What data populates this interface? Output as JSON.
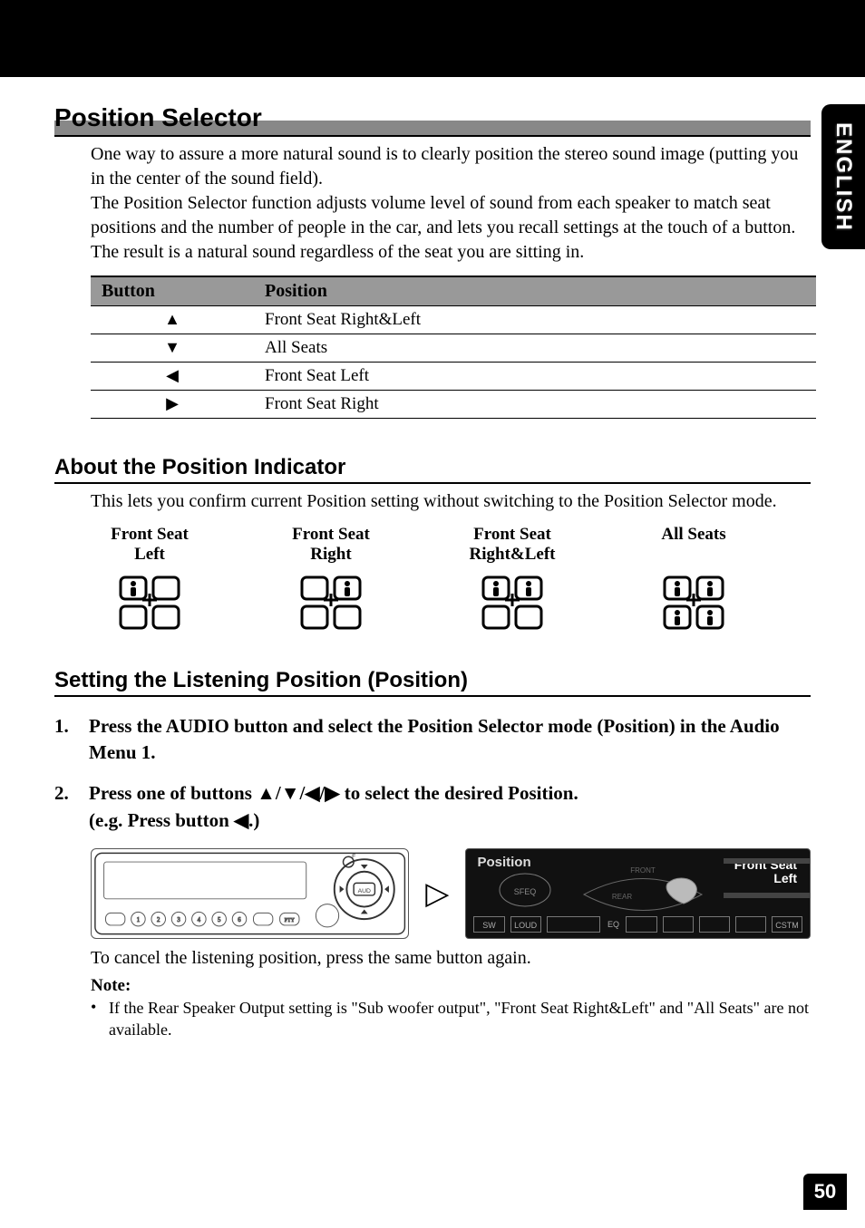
{
  "language_tab": "ENGLISH",
  "page_number": "50",
  "section_title": "Position Selector",
  "intro_paragraph": "One way to assure a more natural sound is to clearly position the stereo sound image (putting you in the center of the sound field).\nThe Position Selector function adjusts volume level of sound from each speaker to match seat positions and the number of people in the car, and lets you recall settings at the touch of a button. The result is a natural sound regardless of the seat you are sitting in.",
  "table": {
    "headers": [
      "Button",
      "Position"
    ],
    "rows": [
      {
        "button": "▲",
        "position": "Front Seat Right&Left"
      },
      {
        "button": "▼",
        "position": "All Seats"
      },
      {
        "button": "◀",
        "position": "Front Seat Left"
      },
      {
        "button": "▶",
        "position": "Front Seat Right"
      }
    ]
  },
  "subsection1": {
    "title": "About the Position Indicator",
    "text": "This lets you confirm current Position setting without switching to the Position Selector mode.",
    "indicators": [
      {
        "line1": "Front Seat",
        "line2": "Left"
      },
      {
        "line1": "Front Seat",
        "line2": "Right"
      },
      {
        "line1": "Front Seat",
        "line2": "Right&Left"
      },
      {
        "line1": "All Seats",
        "line2": ""
      }
    ]
  },
  "subsection2": {
    "title": "Setting the Listening Position (Position)",
    "steps": [
      {
        "num": "1.",
        "text": "Press the AUDIO button and select the Position Selector mode (Position) in the Audio Menu 1."
      },
      {
        "num": "2.",
        "text": "Press one of buttons ▲/▼/◀/▶ to select the desired Position.\n(e.g. Press button ◀.)"
      }
    ],
    "post_image_text": "To cancel the listening position, press the same button again.",
    "note_label": "Note:",
    "note_text": "If the Rear Speaker Output setting is \"Sub woofer output\", \"Front Seat Right&Left\" and \"All Seats\" are not available."
  },
  "display_panel": {
    "title": "Position",
    "readout_line1": "Front Seat",
    "readout_line2": "Left",
    "bottom_icons": [
      "SW",
      "LOUD",
      "",
      "EQ",
      "",
      "",
      "",
      "",
      "CSTM"
    ]
  }
}
